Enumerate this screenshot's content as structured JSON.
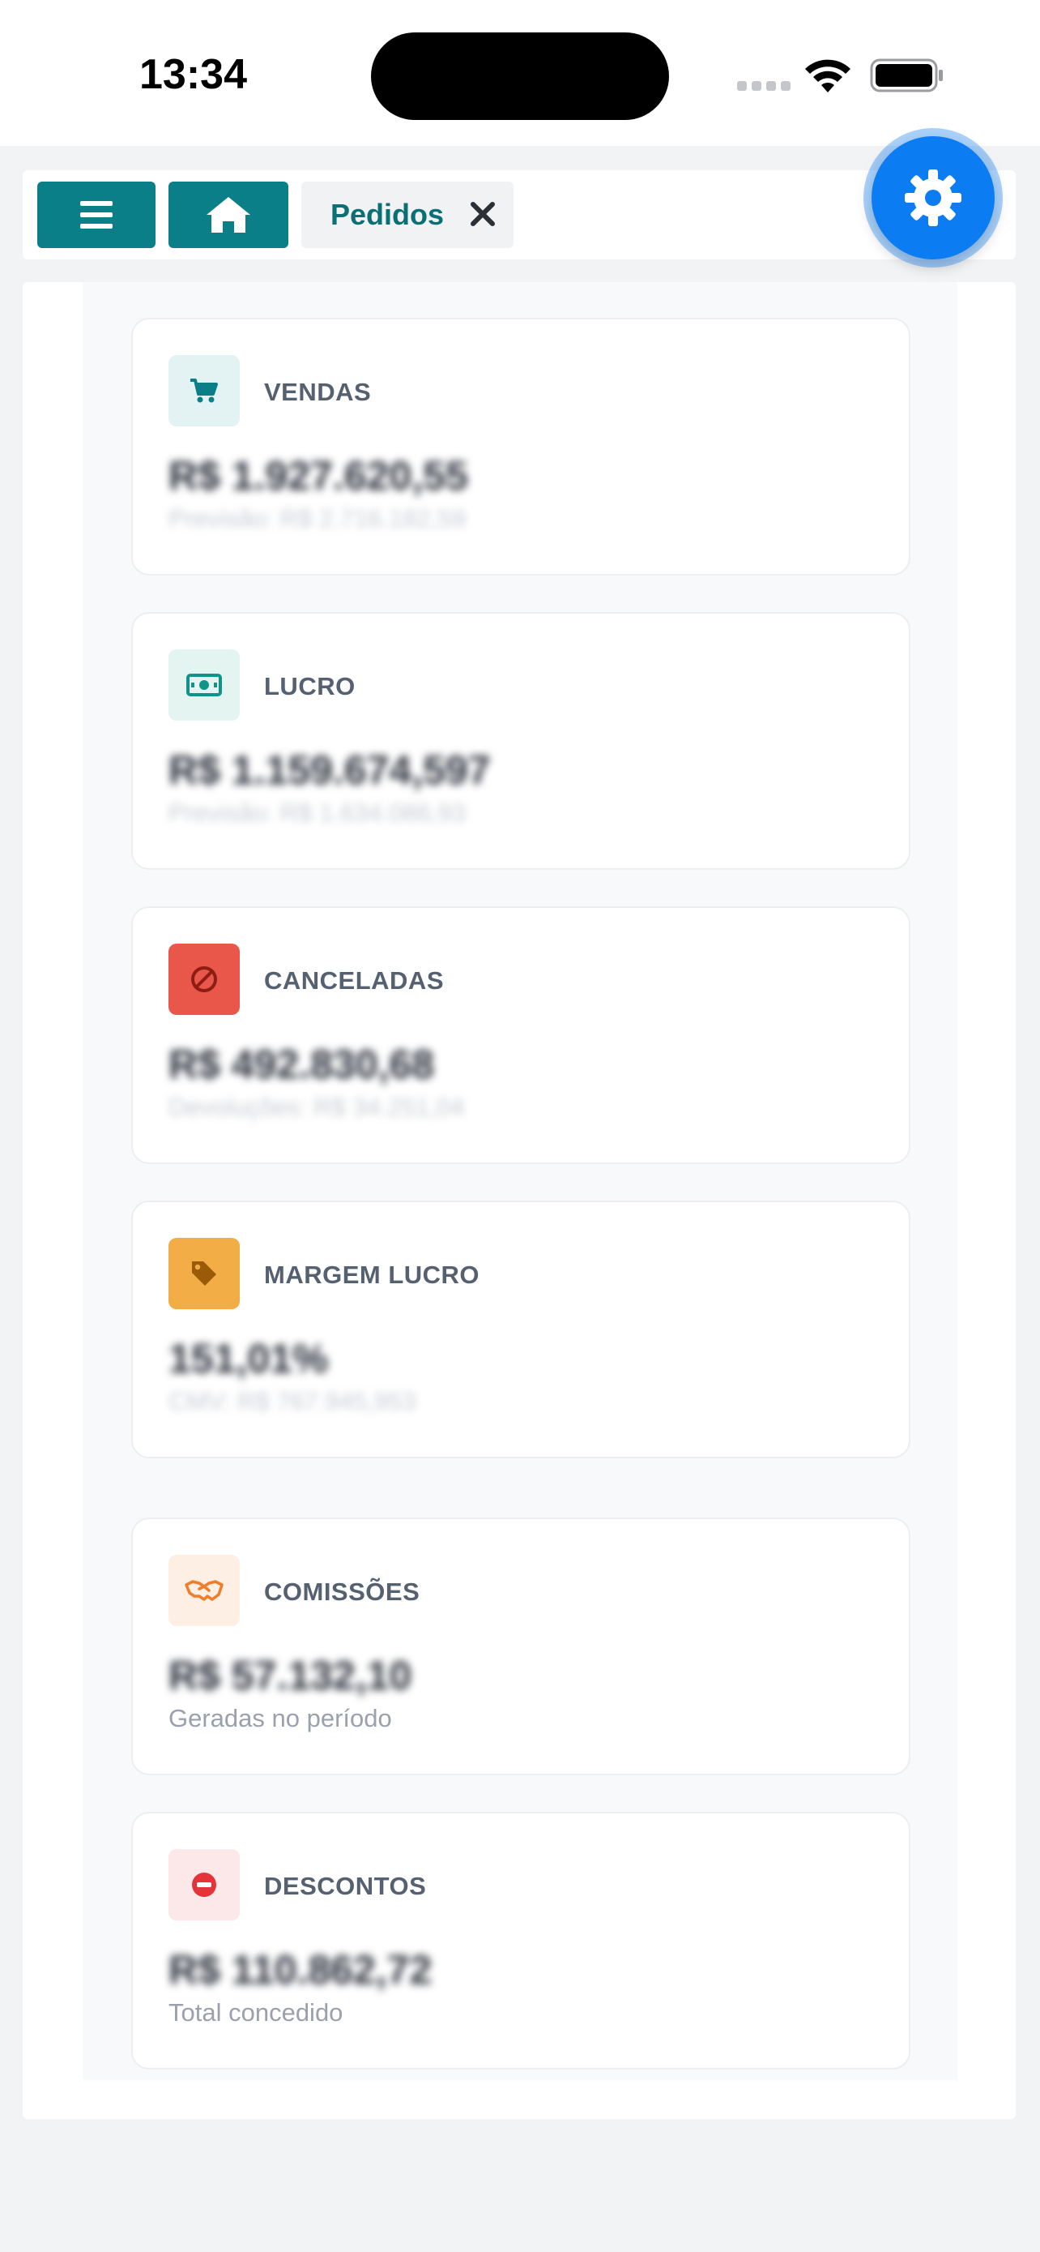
{
  "status_bar": {
    "time": "13:34"
  },
  "toolbar": {
    "menu_icon": "menu-icon",
    "home_icon": "home-icon",
    "tab_label": "Pedidos",
    "tab_close_icon": "close-icon",
    "settings_icon": "gear-icon"
  },
  "colors": {
    "teal": "#0b7f87",
    "fab_blue": "#0c7cf2",
    "red": "#e8574a",
    "orange": "#f3ad47"
  },
  "cards": [
    {
      "title": "VENDAS",
      "value": "R$ 1.927.620,55",
      "subtitle": "Previsão: R$ 2.716.182,59",
      "icon": "cart-icon"
    },
    {
      "title": "LUCRO",
      "value": "R$ 1.159.674,597",
      "subtitle": "Previsão: R$ 1.634.086,93",
      "icon": "money-icon"
    },
    {
      "title": "CANCELADAS",
      "value": "R$ 492.830,68",
      "subtitle": "Devoluções: R$ 34.251,04",
      "icon": "ban-icon"
    },
    {
      "title": "MARGEM LUCRO",
      "value": "151,01%",
      "subtitle": "CMV: R$ 767.945,953",
      "icon": "tag-icon"
    },
    {
      "title": "COMISSÕES",
      "value": "R$ 57.132,10",
      "subtitle": "Geradas no período",
      "icon": "handshake-icon"
    },
    {
      "title": "DESCONTOS",
      "value": "R$ 110.862,72",
      "subtitle": "Total concedido",
      "icon": "minus-circle-icon"
    }
  ]
}
